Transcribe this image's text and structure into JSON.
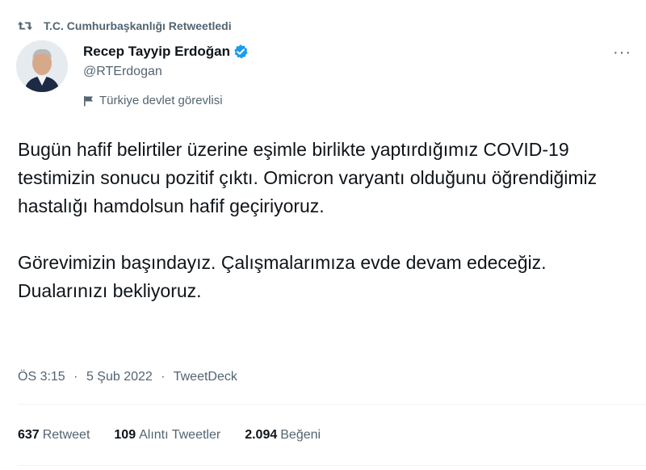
{
  "retweet": {
    "icon": "retweet-icon",
    "text": "T.C. Cumhurbaşkanlığı Retweetledi"
  },
  "author": {
    "avatar": "avatar-photo",
    "name": "Recep Tayyip Erdoğan",
    "verified_icon": "verified-badge-icon",
    "handle": "@RTErdogan",
    "label_icon": "flag-icon",
    "label": "Türkiye devlet görevlisi"
  },
  "more_icon": "more-options-icon",
  "more_label": "···",
  "tweet": {
    "paragraph1": "Bugün hafif belirtiler üzerine eşimle birlikte yaptırdığımız COVID-19 testimizin sonucu pozitif çıktı. Omicron varyantı olduğunu öğrendiğimiz hastalığı hamdolsun hafif geçiriyoruz.",
    "paragraph2": "Görevimizin başındayız. Çalışmalarımıza evde devam edeceğiz. Dualarınızı bekliyoruz."
  },
  "meta": {
    "time": "ÖS 3:15",
    "separator": "·",
    "date": "5 Şub 2022",
    "source": "TweetDeck"
  },
  "stats": {
    "retweets_count": "637",
    "retweets_label": "Retweet",
    "quotes_count": "109",
    "quotes_label": "Alıntı Tweetler",
    "likes_count": "2.094",
    "likes_label": "Beğeni"
  },
  "colors": {
    "text_primary": "#0f1419",
    "text_secondary": "#536471",
    "verified_blue": "#1d9bf0",
    "divider": "#eff3f4"
  }
}
